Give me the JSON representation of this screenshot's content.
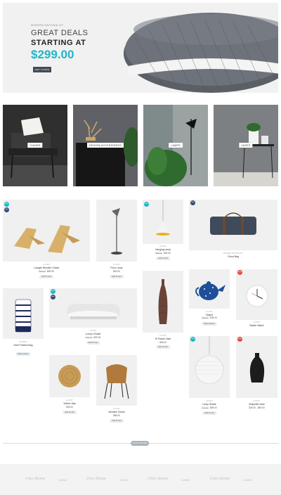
{
  "hero": {
    "subtitle": "Modern Nationalist",
    "line1": "GREAT DEALS",
    "line2": "STARTING AT",
    "price": "$299.00",
    "button": "GET YOURS"
  },
  "categories": [
    {
      "label": "CHAIRS"
    },
    {
      "label": "DESIGN ACCESSORIES"
    },
    {
      "label": "LAMPS"
    },
    {
      "label": "VASES"
    }
  ],
  "products": [
    {
      "brand": "Luxury",
      "title": "Loungie Wooden Chairs",
      "old_price": "$89.00",
      "price": "$59.99",
      "button": "Add To Cart",
      "badges": [
        "20%",
        "Hot"
      ]
    },
    {
      "brand": "Luxury",
      "title": "Floor Lamp",
      "old_price": "",
      "price": "$39.00",
      "button": "Add To Cart",
      "badges": []
    },
    {
      "brand": "Luxury",
      "title": "Hanging Lamp",
      "old_price": "$59.00",
      "price": "$39.00",
      "button": "Add To Cart",
      "badges": [
        "10%"
      ]
    },
    {
      "brand": "Modern Nationalist",
      "title": "Cloud Bag",
      "old_price": "",
      "price": "",
      "button": "",
      "badges": [
        "Hot"
      ]
    },
    {
      "brand": "Luxury",
      "title": "Teapot",
      "old_price": "",
      "price": "",
      "button": "",
      "badges": []
    },
    {
      "brand": "Luxury",
      "title": "Stylish Watch",
      "old_price": "",
      "price": "",
      "button": "",
      "badges": [
        "sale"
      ]
    },
    {
      "brand": "Modern",
      "title": "Nine Position Bag",
      "old_price": "",
      "price": "",
      "button": "Read options",
      "badges": []
    },
    {
      "brand": "Luxury",
      "title": "Luxury Chaise",
      "old_price": "$49.00",
      "price": "$39.00",
      "button": "Add To Cart",
      "badges": [
        "20%",
        "Hot"
      ]
    },
    {
      "brand": "Luxury",
      "title": "St Flower Vase",
      "old_price": "",
      "price": "$36.00",
      "button": "Add To Cart",
      "badges": []
    },
    {
      "brand": "Luxury",
      "title": "Teal Matte",
      "old_price": "$29.00",
      "price": "$39.00",
      "button": "Read options",
      "badges": []
    },
    {
      "brand": "Luxury",
      "title": "Wicker Mat",
      "old_price": "",
      "price": "$39.00",
      "button": "Add To Cart",
      "badges": []
    },
    {
      "brand": "Luxury",
      "title": "Wooden Chairs",
      "old_price": "",
      "price": "$86.00",
      "button": "Add To Cart",
      "badges": []
    },
    {
      "brand": "Luxury",
      "title": "Lamp Shade",
      "old_price": "$79.00",
      "price": "$69.00",
      "button": "Add To Cart",
      "badges": [
        "10%"
      ]
    },
    {
      "brand": "Luxury",
      "title": "Shapelite Vase",
      "old_price": "",
      "price": "$39.00 - $89.00",
      "button": "Add To Cart",
      "badges": [
        "sale"
      ]
    }
  ],
  "load_more": "LOAD MORE",
  "brands": [
    {
      "name": "Chic Home"
    },
    {
      "name": "CASA"
    },
    {
      "name": "Chic Home"
    },
    {
      "name": "CASA"
    },
    {
      "name": "Chic Home"
    },
    {
      "name": "CASA"
    },
    {
      "name": "Chic Home"
    },
    {
      "name": "CASA"
    }
  ],
  "colors": {
    "accent": "#1fb6c8",
    "dark_button": "#444c57",
    "sale_badge": "#e74c3c",
    "hot_badge": "#3b4a7a"
  }
}
